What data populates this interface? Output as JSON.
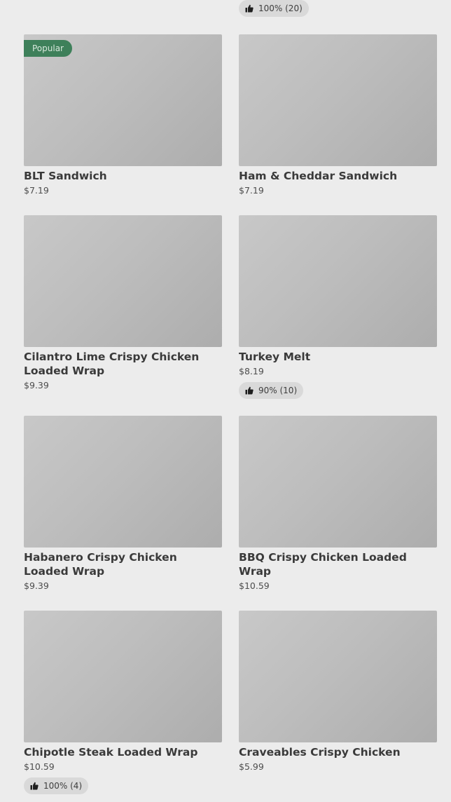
{
  "top_rating": {
    "text": "100% (20)"
  },
  "items": [
    {
      "name": "BLT Sandwich",
      "price": "$7.19",
      "badge": "Popular",
      "rating": ""
    },
    {
      "name": "Ham & Cheddar Sandwich",
      "price": "$7.19",
      "badge": "",
      "rating": ""
    },
    {
      "name": "Cilantro Lime Crispy Chicken Loaded Wrap",
      "price": "$9.39",
      "badge": "",
      "rating": ""
    },
    {
      "name": "Turkey Melt",
      "price": "$8.19",
      "badge": "",
      "rating": "90% (10)"
    },
    {
      "name": "Habanero Crispy Chicken Loaded Wrap",
      "price": "$9.39",
      "badge": "",
      "rating": ""
    },
    {
      "name": "BBQ Crispy Chicken Loaded Wrap",
      "price": "$10.59",
      "badge": "",
      "rating": ""
    },
    {
      "name": "Chipotle Steak Loaded Wrap",
      "price": "$10.59",
      "badge": "",
      "rating": "100% (4)"
    },
    {
      "name": "Craveables Crispy Chicken",
      "price": "$5.99",
      "badge": "",
      "rating": ""
    }
  ],
  "colors": {
    "badge_bg": "#3e805a",
    "page_bg": "#ececec",
    "rating_bg": "#d9d9d9"
  },
  "icons": {
    "rating": "thumbs-up-icon"
  }
}
